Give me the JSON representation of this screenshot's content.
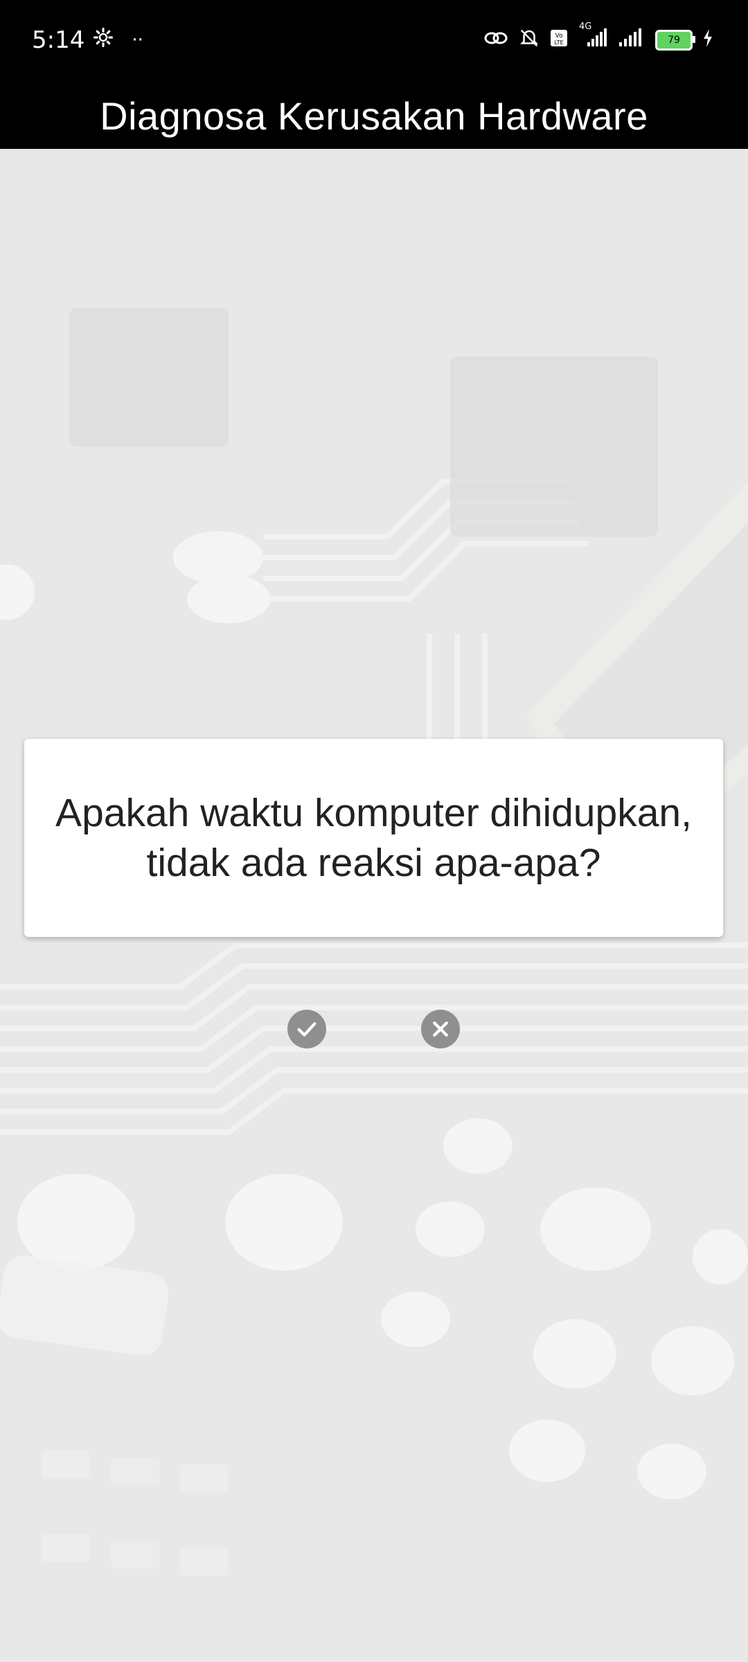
{
  "status_bar": {
    "time": "5:14",
    "battery_level": "79",
    "network_type": "4G",
    "icons": [
      "gear-icon",
      "link-icon",
      "mute-icon",
      "volte-icon",
      "signal-icon",
      "signal-icon",
      "battery-icon",
      "charging-icon"
    ]
  },
  "app_bar": {
    "title": "Diagnosa Kerusakan Hardware"
  },
  "question": {
    "text": "Apakah waktu komputer dihidupkan, tidak ada reaksi apa-apa?"
  },
  "actions": {
    "yes_icon": "check-icon",
    "no_icon": "close-icon"
  },
  "colors": {
    "bar_background": "#000000",
    "content_background": "#e8e8e9",
    "card_background": "#ffffff",
    "button_gray": "#8f8f90",
    "battery_green": "#5fd35f"
  }
}
